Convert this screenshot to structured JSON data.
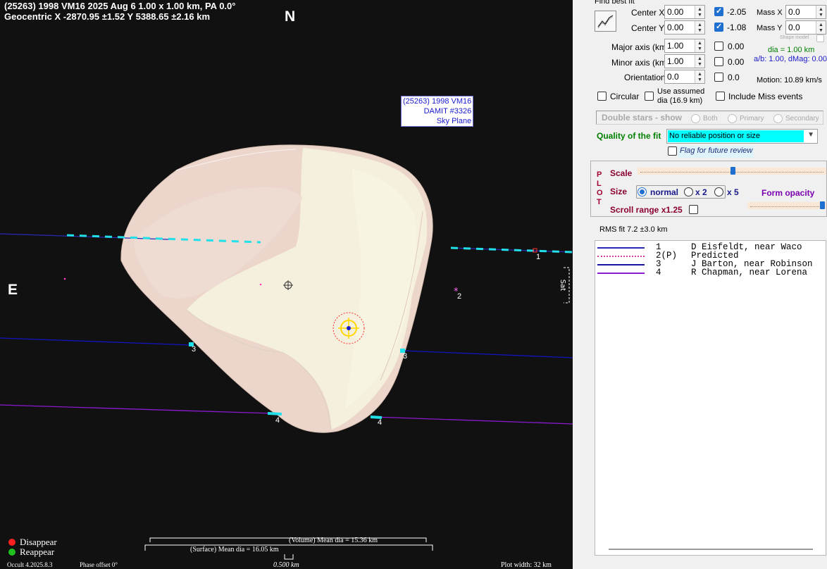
{
  "plot": {
    "header_line1": "(25263) 1998 VM16  2025 Aug 6  1.00 x 1.00 km, PA 0.0°",
    "header_line2": "Geocentric  X  -2870.95 ±1.52  Y 5388.65 ±2.16 km",
    "north_label": "N",
    "east_label": "E",
    "info_box": [
      "(25263) 1998 VM16",
      "DAMIT #3326",
      "Sky Plane"
    ],
    "side_label": "Sat",
    "legend": {
      "disappear": "Disappear",
      "reappear": "Reappear",
      "disappear_color": "#ff2020",
      "reappear_color": "#20c020"
    },
    "volume_mean_dia": "(Volume) Mean dia = 15.36 km",
    "surface_mean_dia": "(Surface) Mean dia = 16.05 km",
    "scale_bar": "0.500 km",
    "version": "Occult 4.2025.8.3",
    "phase_offset": "Phase offset 0°",
    "plot_width": "Plot width: 32 km",
    "chord_labels": [
      "1",
      "2",
      "3",
      "3",
      "4",
      "4"
    ]
  },
  "panel": {
    "find_best_fit": "Find best fit",
    "center_x": {
      "label": "Center X",
      "value": "0.00"
    },
    "center_y": {
      "label": "Center Y",
      "value": "0.00"
    },
    "fit_x": {
      "checked": true,
      "value": "-2.05"
    },
    "fit_y": {
      "checked": true,
      "value": "-1.08"
    },
    "mass_x": {
      "label": "Mass X",
      "value": "0.0"
    },
    "mass_y": {
      "label": "Mass Y",
      "value": "0.0"
    },
    "shape_model_label": "Shape model",
    "major_axis": {
      "label": "Major axis (km)",
      "value": "1.00",
      "fit_value": "0.00"
    },
    "minor_axis": {
      "label": "Minor axis (km)",
      "value": "1.00",
      "fit_value": "0.00"
    },
    "orientation": {
      "label": "Orientation",
      "value": "0.0",
      "fit_value": "0.0"
    },
    "dia_info": "dia = 1.00 km",
    "ab_info": "a/b: 1.00, dMag: 0.00",
    "motion": "Motion: 10.89 km/s",
    "circular": "Circular",
    "use_assumed_line1": "Use assumed",
    "use_assumed_line2": "dia (16.9 km)",
    "include_miss": "Include Miss events",
    "double_stars": "Double stars - show",
    "both": "Both",
    "primary": "Primary",
    "secondary": "Secondary",
    "quality_label": "Quality of the fit",
    "quality_value": "No reliable position or size",
    "flag_review": "Flag for future review",
    "plot_letters": [
      "P",
      "L",
      "O",
      "T"
    ],
    "scale_label": "Scale",
    "size_label": "Size",
    "size_normal": "normal",
    "size_x2": "x 2",
    "size_x5": "x 5",
    "form_opacity": "Form opacity",
    "scroll_range": "Scroll range x1.25",
    "rms_fit": "RMS fit 7.2 ±3.0 km",
    "observers": [
      {
        "num": "1",
        "name": "D Eisfeldt, near Waco",
        "color": "#2a2ab8",
        "style": "solid"
      },
      {
        "num": "2(P)",
        "name": "Predicted",
        "color": "#d03aa0",
        "style": "dotted"
      },
      {
        "num": "3",
        "name": "J Barton, near Robinson",
        "color": "#1414a0",
        "style": "solid"
      },
      {
        "num": "4",
        "name": "R Chapman, near Lorena",
        "color": "#8a1ad0",
        "style": "solid"
      }
    ]
  }
}
